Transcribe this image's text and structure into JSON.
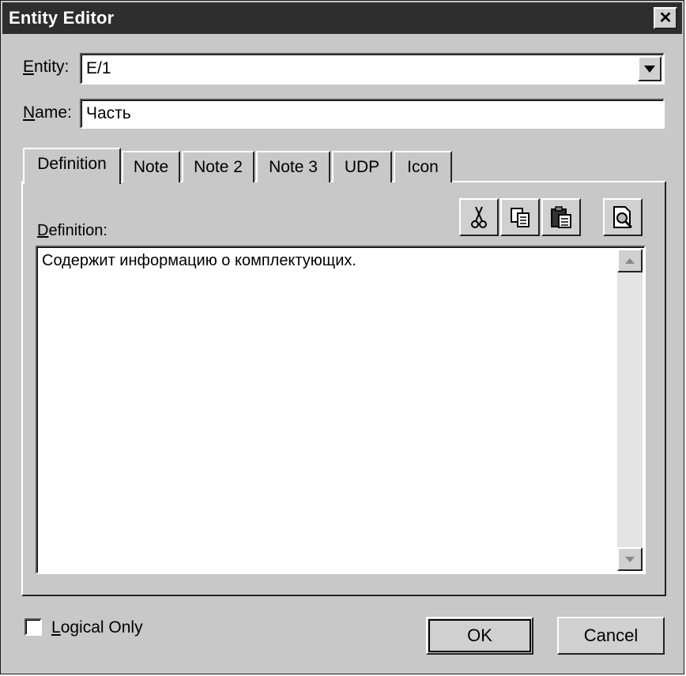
{
  "window": {
    "title": "Entity Editor"
  },
  "entity": {
    "label_prefix": "E",
    "label_rest": "ntity:",
    "value": "E/1"
  },
  "name": {
    "label_prefix": "N",
    "label_rest": "ame:",
    "value": "Часть"
  },
  "tabs": [
    {
      "label": "Definition"
    },
    {
      "label": "Note"
    },
    {
      "label": "Note 2"
    },
    {
      "label": "Note 3"
    },
    {
      "label": "UDP"
    },
    {
      "label": "Icon"
    }
  ],
  "definition": {
    "label_prefix": "D",
    "label_rest": "efinition:",
    "text": "Содержит информацию о комплектующих."
  },
  "toolbar": {
    "cut_icon": "scissors-icon",
    "copy_icon": "copy-icon",
    "paste_icon": "paste-icon",
    "preview_icon": "magnify-page-icon"
  },
  "logical_only": {
    "label_prefix": "L",
    "label_rest": "ogical Only",
    "checked": false
  },
  "buttons": {
    "ok": "OK",
    "cancel": "Cancel"
  }
}
